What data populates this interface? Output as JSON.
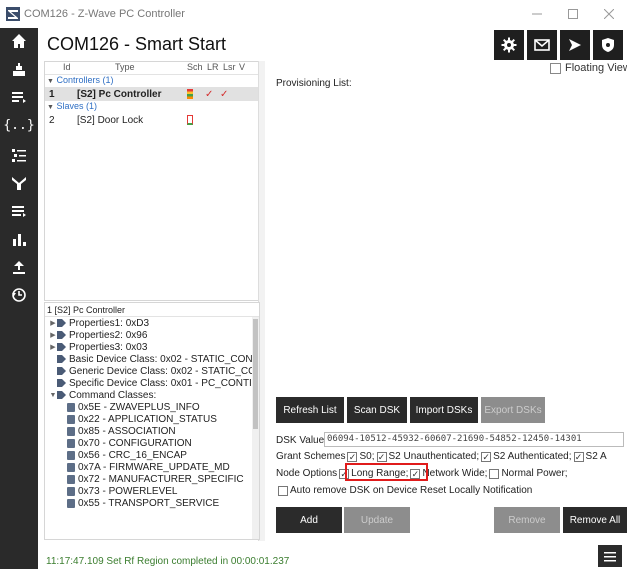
{
  "window": {
    "title": "COM126 - Z-Wave PC Controller",
    "icon": "app-logo-icon"
  },
  "nav": {
    "icons": [
      "home-icon",
      "network-icon",
      "list-icon",
      "braces-icon",
      "tree-list-icon",
      "antenna-icon",
      "sliders-list-icon",
      "bar-chart-icon",
      "upload-icon",
      "history-icon"
    ]
  },
  "header": {
    "title": "COM126 - Smart Start"
  },
  "grid": {
    "columns": [
      "Id",
      "Type",
      "Sch",
      "LR",
      "Lsr",
      "V"
    ],
    "controllers_label": "Controllers (1)",
    "slaves_label": "Slaves (1)",
    "rows": [
      {
        "id": "1",
        "type": "[S2] Pc Controller",
        "lr": "✓",
        "lsr": "✓"
      },
      {
        "id": "2",
        "type": "[S2] Door Lock",
        "lr": "",
        "lsr": ""
      }
    ]
  },
  "details": {
    "header": "1 [S2] Pc Controller",
    "items": [
      {
        "label": "Properties1: 0xD3",
        "level": 0,
        "kind": "collapsed"
      },
      {
        "label": "Properties2: 0x96",
        "level": 0,
        "kind": "collapsed"
      },
      {
        "label": "Properties3: 0x03",
        "level": 0,
        "kind": "collapsed"
      },
      {
        "label": "Basic Device Class: 0x02 - STATIC_CON",
        "level": 0,
        "kind": "leaf"
      },
      {
        "label": "Generic Device Class: 0x02 - STATIC_CC",
        "level": 0,
        "kind": "leaf"
      },
      {
        "label": "Specific Device Class: 0x01 - PC_CONTI",
        "level": 0,
        "kind": "leaf"
      },
      {
        "label": "Command Classes:",
        "level": 0,
        "kind": "expanded"
      },
      {
        "label": "0x5E - ZWAVEPLUS_INFO",
        "level": 1,
        "kind": "cc"
      },
      {
        "label": "0x22 - APPLICATION_STATUS",
        "level": 1,
        "kind": "cc"
      },
      {
        "label": "0x85 - ASSOCIATION",
        "level": 1,
        "kind": "cc"
      },
      {
        "label": "0x70 - CONFIGURATION",
        "level": 1,
        "kind": "cc"
      },
      {
        "label": "0x56 - CRC_16_ENCAP",
        "level": 1,
        "kind": "cc"
      },
      {
        "label": "0x7A - FIRMWARE_UPDATE_MD",
        "level": 1,
        "kind": "cc"
      },
      {
        "label": "0x72 - MANUFACTURER_SPECIFIC",
        "level": 1,
        "kind": "cc"
      },
      {
        "label": "0x73 - POWERLEVEL",
        "level": 1,
        "kind": "cc"
      },
      {
        "label": "0x55 - TRANSPORT_SERVICE",
        "level": 1,
        "kind": "cc"
      }
    ]
  },
  "panel": {
    "floating_label": "Floating View",
    "provisioning_label": "Provisioning List:",
    "buttons": {
      "refresh": "Refresh List",
      "scan": "Scan DSK",
      "import": "Import DSKs",
      "export": "Export DSKs",
      "add": "Add",
      "update": "Update",
      "remove": "Remove",
      "remove_all": "Remove All"
    },
    "dsk_label": "DSK Value",
    "dsk_value": "06094-10512-45932-60607-21690-54852-12450-14301",
    "grant_label": "Grant Schemes",
    "grant": {
      "s0": "S0;",
      "s2_unauth": "S2 Unauthenticated;",
      "s2_auth": "S2 Authenticated;",
      "s2_access": "S2 A"
    },
    "node_options_label": "Node Options",
    "options": {
      "long_range": "Long Range;",
      "network_wide": "Network Wide;",
      "normal_power": "Normal Power;"
    },
    "auto_remove": "Auto remove DSK on Device Reset Locally Notification"
  },
  "status": {
    "text": "11:17:47.109 Set Rf Region completed in 00:00:01.237"
  },
  "colors": {
    "nav_bg": "#2a2a2a",
    "button_bg": "#2b2b2b",
    "highlight": "#e01b1b",
    "status_text": "#3a7d2e"
  }
}
